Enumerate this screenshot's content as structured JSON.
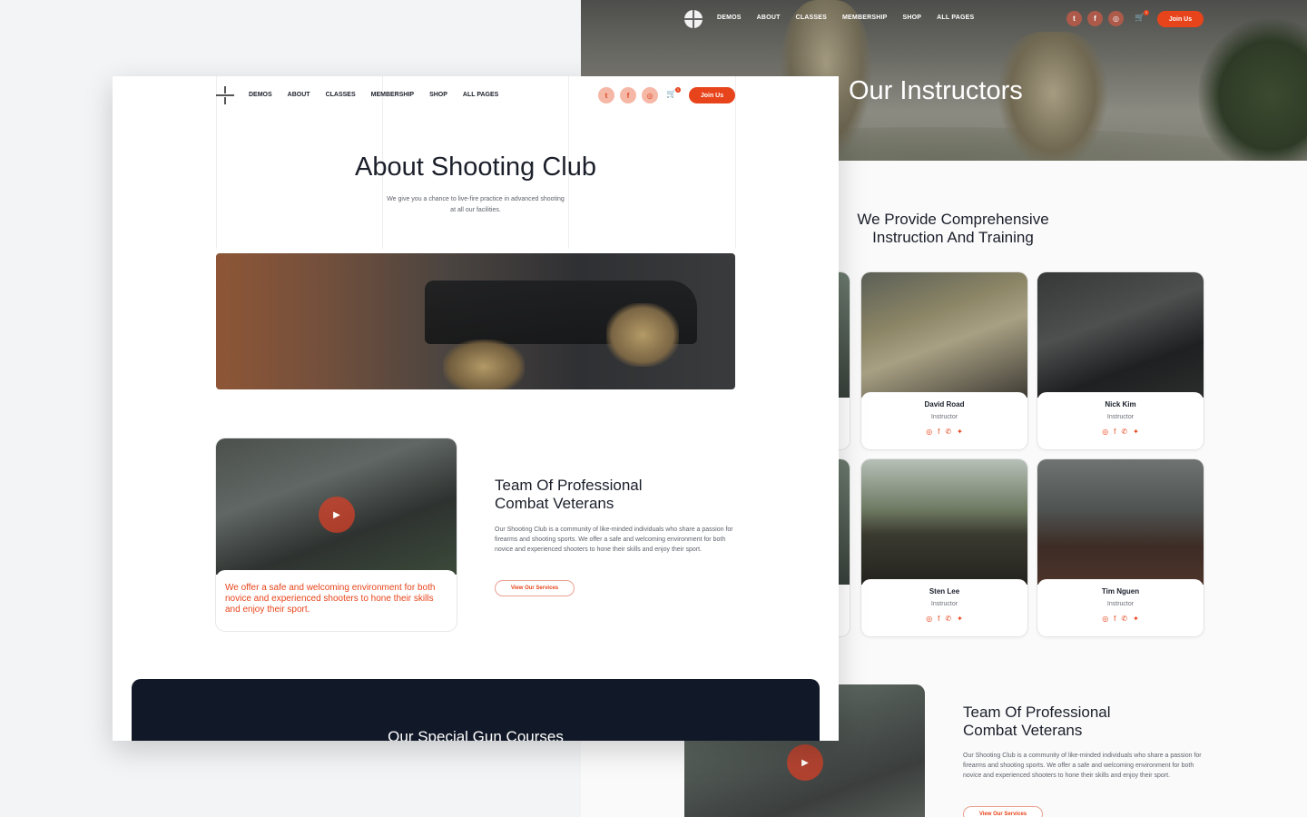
{
  "back_page": {
    "nav": {
      "menu": [
        "DEMOS",
        "ABOUT",
        "CLASSES",
        "MEMBERSHIP",
        "SHOP",
        "ALL PAGES"
      ],
      "cart_count": "1",
      "join_label": "Join Us"
    },
    "hero_title": "Our Instructors",
    "section_title": "We Provide Comprehensive Instruction And Training",
    "instructors": [
      {
        "name": "David Road",
        "role": "Instructor"
      },
      {
        "name": "Nick Kim",
        "role": "Instructor"
      },
      {
        "name": "Sten Lee",
        "role": "Instructor"
      },
      {
        "name": "Tim Nguen",
        "role": "Instructor"
      }
    ],
    "feature": {
      "title_line1": "Team Of Professional",
      "title_line2": "Combat Veterans",
      "text": "Our Shooting Club is a community of like-minded individuals who share a passion for firearms and shooting sports. We offer a safe and welcoming environment for both novice and experienced shooters to hone their skills and enjoy their sport.",
      "button": "View Our Services"
    }
  },
  "front_page": {
    "nav": {
      "menu": [
        "DEMOS",
        "ABOUT",
        "CLASSES",
        "MEMBERSHIP",
        "SHOP",
        "ALL PAGES"
      ],
      "cart_count": "1",
      "join_label": "Join Us"
    },
    "title": "About Shooting Club",
    "subtitle": "We give you a chance to live-fire practice in advanced shooting at all our facilities.",
    "video_caption": "We offer a safe and welcoming environment for both novice and experienced shooters to hone their skills and enjoy their sport.",
    "feature": {
      "title_line1": "Team Of Professional",
      "title_line2": "Combat Veterans",
      "text": "Our Shooting Club is a community of like-minded individuals who share a passion for firearms and shooting sports. We offer a safe and welcoming environment for both novice and experienced shooters to hone their skills and enjoy their sport.",
      "button": "View Our Services"
    },
    "courses_title": "Our Special Gun Courses"
  },
  "icons": {
    "social": [
      "twitter-icon",
      "facebook-icon",
      "instagram-icon"
    ],
    "instructor_social": [
      "instagram-icon",
      "facebook-icon",
      "whatsapp-icon",
      "twitter-icon"
    ],
    "cart": "cart-icon",
    "play": "play-icon"
  },
  "colors": {
    "accent": "#e8441b",
    "dark_section": "#111827",
    "text": "#1b1f2a"
  }
}
